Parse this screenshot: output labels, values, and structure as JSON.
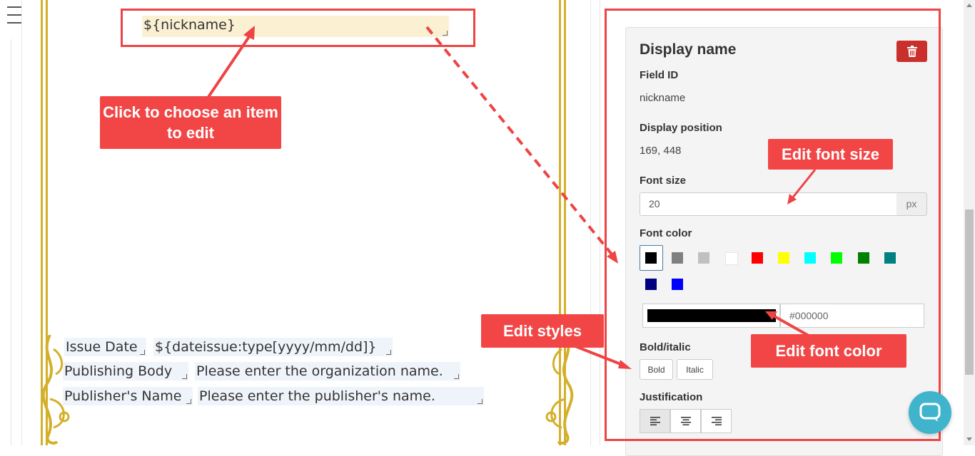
{
  "canvas": {
    "nickname_field": "${nickname}",
    "issue_date_label": "Issue Date",
    "issue_date_value": "${dateissue:type[yyyy/mm/dd]}",
    "publishing_body_label": "Publishing Body",
    "publishing_body_value": "Please enter the organization name.",
    "publisher_name_label": "Publisher's Name",
    "publisher_name_value": "Please enter the publisher's name."
  },
  "callouts": {
    "choose_item": "Click to choose an item to edit",
    "font_size": "Edit font size",
    "styles": "Edit styles",
    "font_color": "Edit font color"
  },
  "panel": {
    "title": "Display name",
    "field_id_label": "Field ID",
    "field_id_value": "nickname",
    "position_label": "Display position",
    "position_value": "169, 448",
    "font_size_label": "Font size",
    "font_size_value": "20",
    "font_size_unit": "px",
    "font_color_label": "Font color",
    "swatches": [
      "#000000",
      "#808080",
      "#c0c0c0",
      "#ffffff",
      "#ff0000",
      "#ffff00",
      "#00ffff",
      "#00ff00",
      "#008000",
      "#008080",
      "#000080",
      "#0000ff"
    ],
    "selected_color": "#000000",
    "hex_value": "#000000",
    "bold_italic_label": "Bold/italic",
    "bold_label": "Bold",
    "italic_label": "Italic",
    "justification_label": "Justification"
  },
  "colors": {
    "accent_red": "#f24646",
    "frame_gold": "#d4b02a",
    "delete_red": "#c9302c",
    "chat_teal": "#3fb4cc"
  }
}
